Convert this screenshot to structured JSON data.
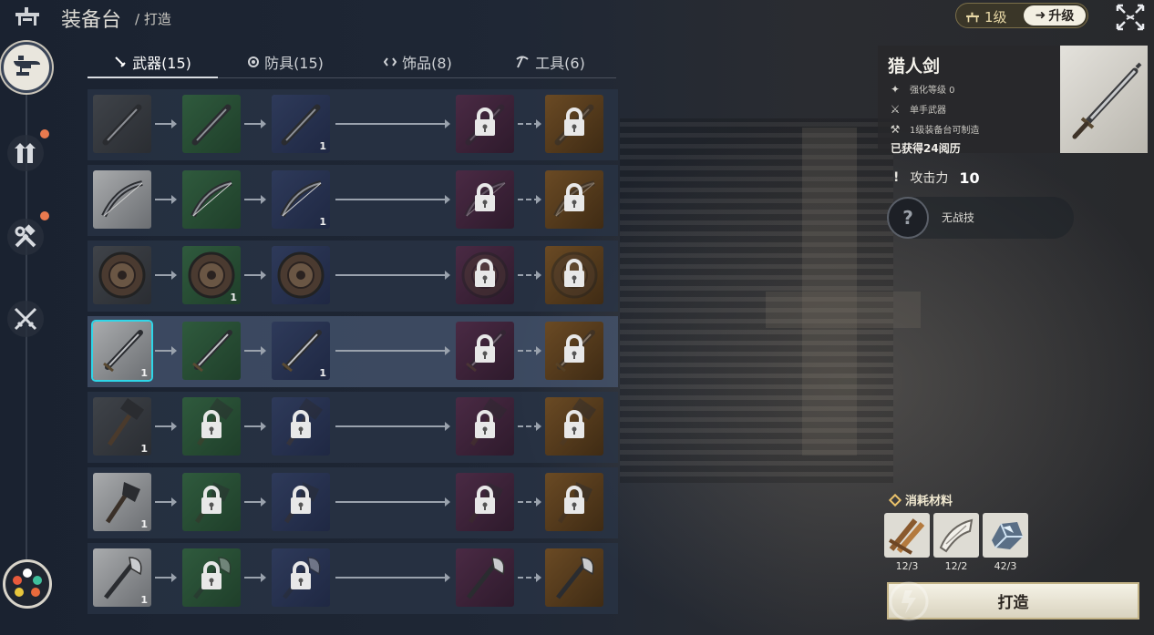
{
  "header": {
    "title": "装备台",
    "subtitle": "/ 打造",
    "level_label": "1级",
    "upgrade_label": "升级"
  },
  "tabs": [
    {
      "label": "武器(15)",
      "icon": "sword-icon",
      "active": true
    },
    {
      "label": "防具(15)",
      "icon": "shield-icon",
      "active": false
    },
    {
      "label": "饰品(8)",
      "icon": "accessory-icon",
      "active": false
    },
    {
      "label": "工具(6)",
      "icon": "pickaxe-icon",
      "active": false
    }
  ],
  "grid": {
    "rows": [
      {
        "kind": "greatsword",
        "counts": [
          "",
          "",
          "1",
          "",
          ""
        ],
        "locked": [
          false,
          false,
          false,
          true,
          true
        ]
      },
      {
        "kind": "bow",
        "counts": [
          "",
          "",
          "1",
          "",
          ""
        ],
        "locked": [
          false,
          false,
          false,
          true,
          true
        ]
      },
      {
        "kind": "round-shield",
        "counts": [
          "",
          "1",
          "",
          "",
          ""
        ],
        "locked": [
          false,
          false,
          false,
          true,
          true
        ]
      },
      {
        "kind": "hunter-sword",
        "counts": [
          "1",
          "",
          "1",
          "",
          ""
        ],
        "locked": [
          false,
          false,
          false,
          true,
          true
        ],
        "selected": true
      },
      {
        "kind": "hammer",
        "counts": [
          "1",
          "",
          "",
          "",
          ""
        ],
        "locked": [
          false,
          true,
          true,
          true,
          true
        ]
      },
      {
        "kind": "axe",
        "counts": [
          "1",
          "",
          "",
          "",
          ""
        ],
        "locked": [
          false,
          true,
          true,
          true,
          true
        ]
      },
      {
        "kind": "glaive",
        "counts": [
          "1",
          "",
          "",
          "",
          ""
        ],
        "locked": [
          false,
          true,
          true,
          false,
          false
        ]
      }
    ]
  },
  "detail": {
    "name": "猎人剑",
    "enhance": "强化等级 0",
    "weapon_type": "单手武器",
    "craftable": "1级装备台可制造",
    "xp": "已获得24阅历",
    "attack_label": "攻击力",
    "attack_value": "10",
    "skill_label": "无战技"
  },
  "materials": {
    "title": "消耗材料",
    "items": [
      {
        "icon": "wood-planks-icon",
        "count": "12/3"
      },
      {
        "icon": "leather-strip-icon",
        "count": "12/2"
      },
      {
        "icon": "crystal-ore-icon",
        "count": "42/3"
      }
    ]
  },
  "craft_label": "打造",
  "colors": {
    "selected_outline": "#2fd6e8",
    "notification_dot": "#e97a4f",
    "tier_green": "#2f5a3d",
    "tier_blue": "#2e3a5a",
    "tier_purple": "#4a2a44",
    "tier_orange": "#6a4a24"
  }
}
